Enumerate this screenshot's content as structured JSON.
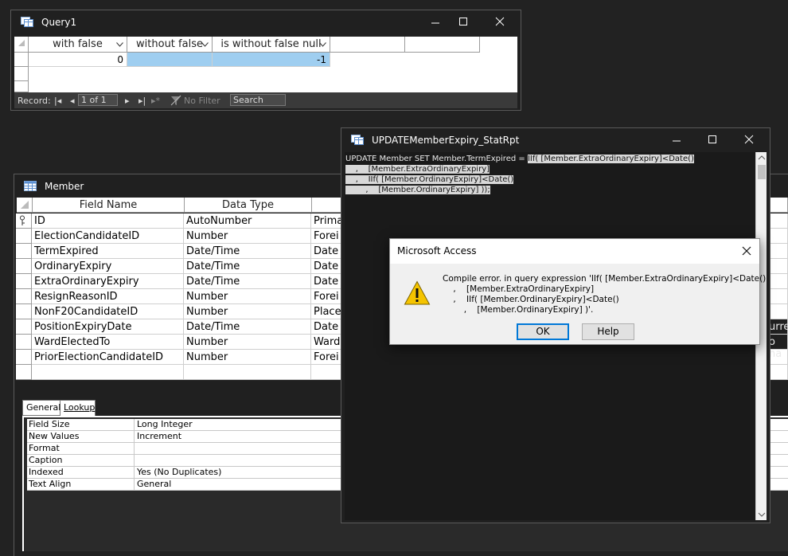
{
  "query_window": {
    "title": "Query1",
    "columns": [
      "with false",
      "without false",
      "is without false null"
    ],
    "row": [
      "0",
      "",
      "-1"
    ],
    "nav": {
      "record_label": "Record:",
      "position": "1 of 1",
      "filter": "No Filter",
      "search": "Search"
    }
  },
  "member_window": {
    "title": "Member",
    "columns": [
      "Field Name",
      "Data Type"
    ],
    "rows": [
      {
        "name": "ID",
        "type": "AutoNumber",
        "desc": "Prima"
      },
      {
        "name": "ElectionCandidateID",
        "type": "Number",
        "desc": "Forei"
      },
      {
        "name": "TermExpired",
        "type": "Date/Time",
        "desc": "Date"
      },
      {
        "name": "OrdinaryExpiry",
        "type": "Date/Time",
        "desc": "Date"
      },
      {
        "name": "ExtraOrdinaryExpiry",
        "type": "Date/Time",
        "desc": "Date"
      },
      {
        "name": "ResignReasonID",
        "type": "Number",
        "desc": "Forei"
      },
      {
        "name": "NonF20CandidateID",
        "type": "Number",
        "desc": "Place"
      },
      {
        "name": "PositionExpiryDate",
        "type": "Date/Time",
        "desc": "Date"
      },
      {
        "name": "WardElectedTo",
        "type": "Number",
        "desc": "Ward"
      },
      {
        "name": "PriorElectionCandidateID",
        "type": "Number",
        "desc": "Forei"
      }
    ],
    "tabs": [
      "General",
      "Lookup"
    ],
    "properties": [
      {
        "label": "Field Size",
        "value": "Long Integer"
      },
      {
        "label": "New Values",
        "value": "Increment"
      },
      {
        "label": "Format",
        "value": ""
      },
      {
        "label": "Caption",
        "value": ""
      },
      {
        "label": "Indexed",
        "value": "Yes (No Duplicates)"
      },
      {
        "label": "Text Align",
        "value": "General"
      }
    ],
    "clipped_right": [
      "urre",
      "o ha"
    ]
  },
  "sql_window": {
    "title": "UPDATEMemberExpiry_StatRpt",
    "line1_plain": "UPDATE Member SET Member.TermExpired = ",
    "line1_sel": "IIf( [Member.ExtraOrdinaryExpiry]<Date()",
    "line2": "    ,    [Member.ExtraOrdinaryExpiry]",
    "line3": "    ,    IIf( [Member.OrdinaryExpiry]<Date()",
    "line4": "        ,    [Member.OrdinaryExpiry] ));"
  },
  "dialog": {
    "title": "Microsoft Access",
    "message": "Compile error. in query expression 'IIf( [Member.ExtraOrdinaryExpiry]<Date()\n    ,    [Member.ExtraOrdinaryExpiry]\n    ,    IIf( [Member.OrdinaryExpiry]<Date()\n        ,    [Member.OrdinaryExpiry] )'.",
    "ok_label": "OK",
    "help_label": "Help"
  },
  "colors": {
    "selection": "#9fcef0",
    "dialog_default_border": "#0078d7",
    "warning": "#f5c400"
  }
}
